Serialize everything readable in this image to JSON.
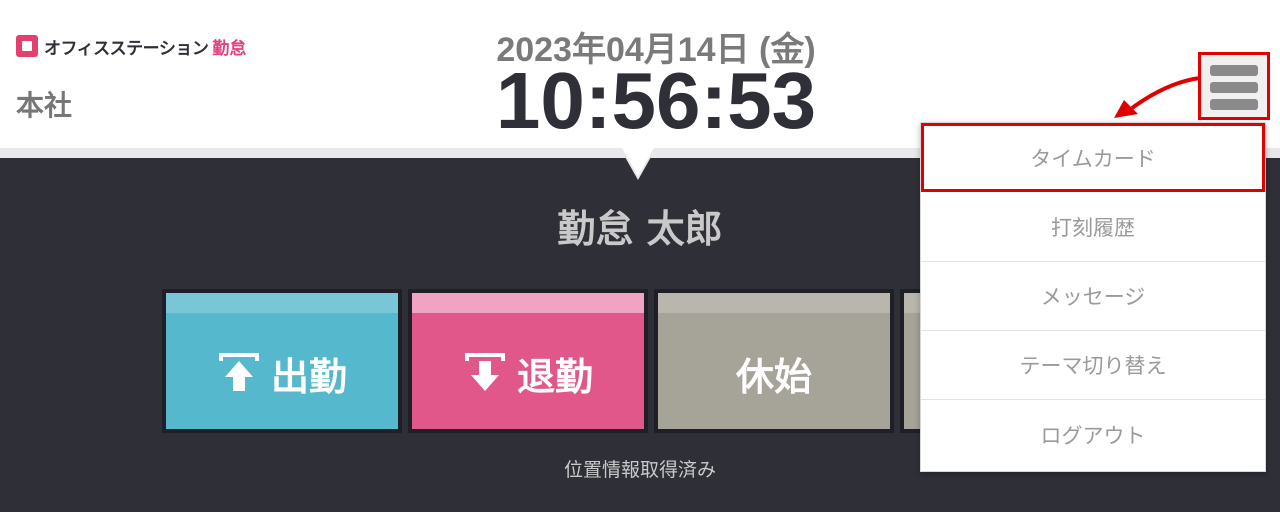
{
  "header": {
    "logo_text": "オフィスステーション",
    "logo_accent": "勤怠",
    "office_name": "本社",
    "date": "2023年04月14日 (金)",
    "time": "10:56:53",
    "menu_icon": "hamburger-menu-icon"
  },
  "main": {
    "user_name": "勤怠 太郎",
    "location_status": "位置情報取得済み",
    "buttons": [
      {
        "label": "出勤",
        "icon": "clock-in-arrow-up-icon",
        "color": "#56b8cc"
      },
      {
        "label": "退勤",
        "icon": "clock-out-arrow-down-icon",
        "color": "#e2578a"
      },
      {
        "label": "休始",
        "icon": "",
        "color": "#a6a398"
      }
    ]
  },
  "menu": {
    "items": [
      {
        "label": "タイムカード",
        "highlighted": true
      },
      {
        "label": "打刻履歴"
      },
      {
        "label": "メッセージ"
      },
      {
        "label": "テーマ切り替え"
      },
      {
        "label": "ログアウト"
      }
    ]
  },
  "colors": {
    "annotation": "#e00000",
    "background": "#2e2f37",
    "brand": "#e3407f"
  }
}
